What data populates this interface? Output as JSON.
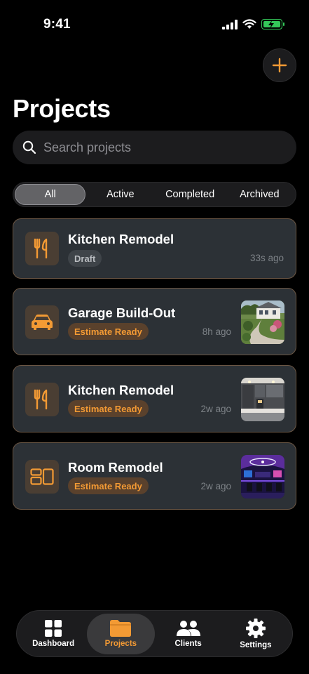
{
  "status_bar": {
    "time": "9:41"
  },
  "header": {
    "title": "Projects",
    "add_icon": "plus-icon"
  },
  "search": {
    "placeholder": "Search projects",
    "value": ""
  },
  "filters": {
    "selected": "All",
    "options": [
      "All",
      "Active",
      "Completed",
      "Archived"
    ]
  },
  "projects": [
    {
      "title": "Kitchen Remodel",
      "status": "Draft",
      "time": "33s ago",
      "icon": "utensils-icon",
      "thumbnail": ""
    },
    {
      "title": "Garage Build-Out",
      "status": "Estimate Ready",
      "time": "8h ago",
      "icon": "car-icon",
      "thumbnail": "house-walkway-photo"
    },
    {
      "title": "Kitchen Remodel",
      "status": "Estimate Ready",
      "time": "2w ago",
      "icon": "utensils-icon",
      "thumbnail": "modern-kitchen-photo"
    },
    {
      "title": "Room Remodel",
      "status": "Estimate Ready",
      "time": "2w ago",
      "icon": "layout-icon",
      "thumbnail": "gaming-room-photo"
    }
  ],
  "tab_bar": {
    "tabs": [
      {
        "label": "Dashboard",
        "icon": "grid-icon",
        "active": false
      },
      {
        "label": "Projects",
        "icon": "folder-icon",
        "active": true
      },
      {
        "label": "Clients",
        "icon": "people-icon",
        "active": false
      },
      {
        "label": "Settings",
        "icon": "gear-icon",
        "active": false
      }
    ]
  },
  "colors": {
    "accent": "#f39a34",
    "background": "#000000",
    "card": "#2c3136",
    "card_border": "#6b5644",
    "battery": "#34c759"
  }
}
